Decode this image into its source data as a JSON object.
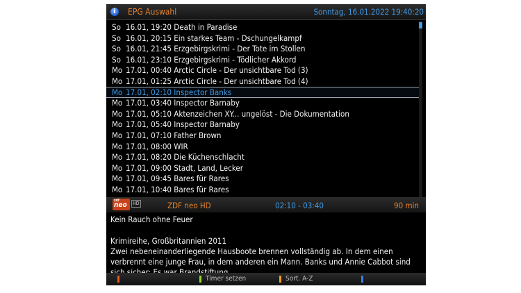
{
  "header": {
    "title": "EPG Auswahl",
    "clock": "Sonntag, 16.01.2022  19:40:20",
    "info_icon": "info-icon"
  },
  "epg_list": [
    {
      "day": "So",
      "datetime": "16.01, 19:20",
      "title": "Death in Paradise",
      "selected": false
    },
    {
      "day": "So",
      "datetime": "16.01, 20:15",
      "title": "Ein starkes Team - Dschungelkampf",
      "selected": false
    },
    {
      "day": "So",
      "datetime": "16.01, 21:45",
      "title": "Erzgebirgskrimi - Der Tote im Stollen",
      "selected": false
    },
    {
      "day": "So",
      "datetime": "16.01, 23:10",
      "title": "Erzgebirgskrimi - Tödlicher Akkord",
      "selected": false
    },
    {
      "day": "Mo",
      "datetime": "17.01, 00:40",
      "title": "Arctic Circle - Der unsichtbare Tod (3)",
      "selected": false
    },
    {
      "day": "Mo",
      "datetime": "17.01, 01:25",
      "title": "Arctic Circle - Der unsichtbare Tod (4)",
      "selected": false
    },
    {
      "day": "Mo",
      "datetime": "17.01, 02:10",
      "title": "Inspector Banks",
      "selected": true
    },
    {
      "day": "Mo",
      "datetime": "17.01, 03:40",
      "title": "Inspector Barnaby",
      "selected": false
    },
    {
      "day": "Mo",
      "datetime": "17.01, 05:10",
      "title": "Aktenzeichen XY... ungelöst - Die Dokumentation",
      "selected": false
    },
    {
      "day": "Mo",
      "datetime": "17.01, 05:40",
      "title": "Inspector Barnaby",
      "selected": false
    },
    {
      "day": "Mo",
      "datetime": "17.01, 07:10",
      "title": "Father Brown",
      "selected": false
    },
    {
      "day": "Mo",
      "datetime": "17.01, 08:00",
      "title": "WIR",
      "selected": false
    },
    {
      "day": "Mo",
      "datetime": "17.01, 08:20",
      "title": "Die Küchenschlacht",
      "selected": false
    },
    {
      "day": "Mo",
      "datetime": "17.01, 09:00",
      "title": "Stadt, Land, Lecker",
      "selected": false
    },
    {
      "day": "Mo",
      "datetime": "17.01, 09:45",
      "title": "Bares für Rares",
      "selected": false
    },
    {
      "day": "Mo",
      "datetime": "17.01, 10:40",
      "title": "Bares für Rares",
      "selected": false
    }
  ],
  "channel": {
    "logo_small": "zdf",
    "logo_main": "neo",
    "hd_badge": "HD",
    "name": "ZDF neo HD",
    "time_range": "02:10 - 03:40",
    "duration": "90 min"
  },
  "detail": {
    "event_title": "Kein Rauch ohne Feuer",
    "genre": "Krimireihe, Großbritannien 2011",
    "description": "Zwei nebeneinanderliegende Hausboote brennen vollständig ab. In dem einen verbrennt eine junge Frau, in dem anderen ein Mann. Banks und Annie Cabbot sind sich sicher: Es war Brandstiftung."
  },
  "footer": {
    "red_label": "",
    "green_label": "Timer setzen",
    "yellow_label": "Sort. A-Z",
    "blue_label": ""
  },
  "colors": {
    "accent_orange": "#e8832a",
    "accent_blue": "#3f9be6",
    "key_red": "#e05a20",
    "key_green": "#8fdc2a",
    "key_yellow": "#f0a020",
    "key_blue": "#3f7ee6"
  }
}
